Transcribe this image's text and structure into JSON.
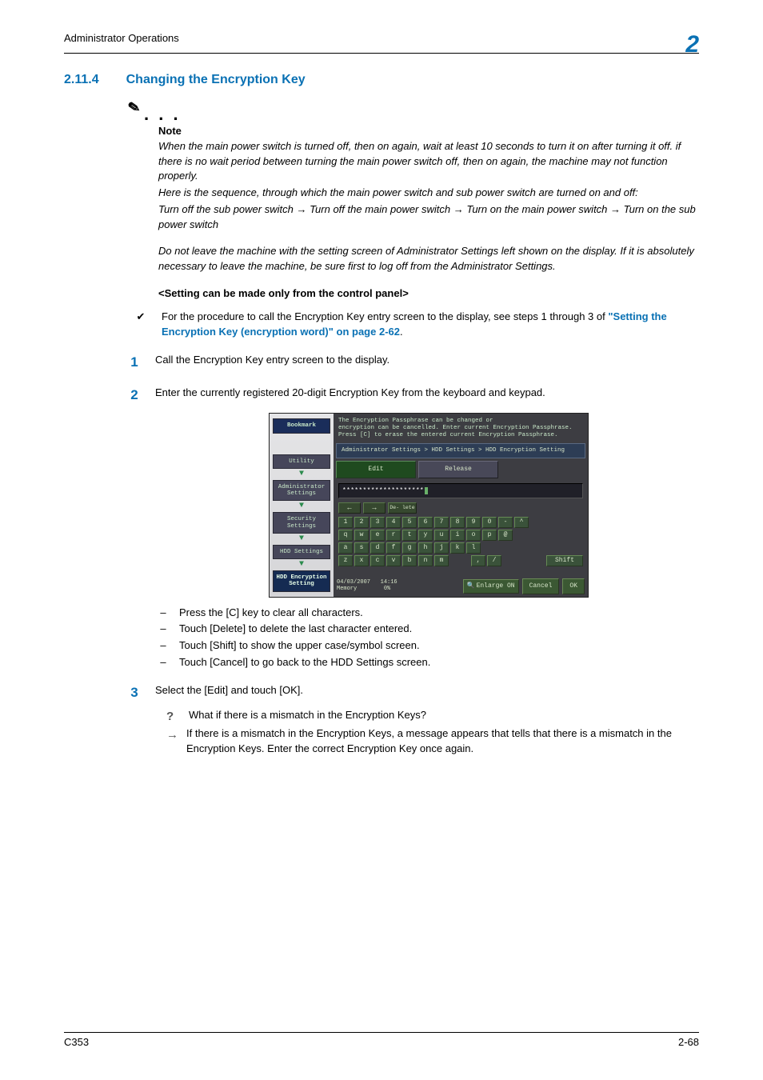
{
  "header": {
    "left": "Administrator Operations",
    "num": "2"
  },
  "section": {
    "num": "2.11.4",
    "title": "Changing the Encryption Key"
  },
  "note": {
    "label": "Note",
    "p1": "When the main power switch is turned off, then on again, wait at least 10 seconds to turn it on after turning it off. if there is no wait period between turning the main power switch off, then on again, the machine may not function properly.",
    "p2": "Here is the sequence, through which the main power switch and sub power switch are turned on and off:",
    "p3_a": "Turn off the sub power switch ",
    "p3_b": " Turn off the main power switch ",
    "p3_c": " Turn on the main power switch ",
    "p3_d": " Turn on the sub power switch",
    "p4": "Do not leave the machine with the setting screen of Administrator Settings left shown on the display. If it is absolutely necessary to leave the machine, be sure first to log off from the Administrator Settings."
  },
  "subheading": "<Setting can be made only from the control panel>",
  "bullet": {
    "text_a": "For the procedure to call the Encryption Key entry screen to the display, see steps 1 through 3 of ",
    "link": "\"Setting the Encryption Key (encryption word)\" on page 2-62",
    "text_b": "."
  },
  "step1": "Call the Encryption Key entry screen to the display.",
  "step2": "Enter the currently registered 20-digit Encryption Key from the keyboard and keypad.",
  "dash": {
    "d1": "Press the [C] key to clear all characters.",
    "d2": "Touch [Delete] to delete the last character entered.",
    "d3": "Touch [Shift] to show the upper case/symbol screen.",
    "d4": "Touch [Cancel] to go back to the HDD Settings screen."
  },
  "step3": "Select the [Edit] and touch [OK].",
  "faq": {
    "q": "What if there is a mismatch in the Encryption Keys?",
    "a": "If there is a mismatch in the Encryption Keys, a message appears that tells that there is a mismatch in the Encryption Keys. Enter the correct Encryption Key once again."
  },
  "panel": {
    "msg1": "The Encryption Passphrase can be changed or",
    "msg2": "encryption can be cancelled. Enter current Encryption Passphrase.",
    "msg3": "Press [C] to erase the entered current Encryption Passphrase.",
    "crumb": "Administrator Settings > HDD Settings > HDD Encryption Setting",
    "tab_edit": "Edit",
    "tab_release": "Release",
    "value": "********************",
    "left": {
      "bookmark": "Bookmark",
      "utility": "Utility",
      "admin": "Administrator Settings",
      "security": "Security Settings",
      "hdd": "HDD Settings",
      "enc": "HDD Encryption Setting"
    },
    "del": "De- lete",
    "shift": "Shift",
    "row1": [
      "1",
      "2",
      "3",
      "4",
      "5",
      "6",
      "7",
      "8",
      "9",
      "0",
      "-",
      "^"
    ],
    "row2": [
      "q",
      "w",
      "e",
      "r",
      "t",
      "y",
      "u",
      "i",
      "o",
      "p",
      "@"
    ],
    "row3": [
      "a",
      "s",
      "d",
      "f",
      "g",
      "h",
      "j",
      "k",
      "l"
    ],
    "row4": [
      "z",
      "x",
      "c",
      "v",
      "b",
      "n",
      "m"
    ],
    "row4b": [
      ",",
      "/"
    ],
    "foot_date": "04/03/2007",
    "foot_time": "14:16",
    "foot_mem": "Memory",
    "foot_memv": "0%",
    "enlarge": "Enlarge ON",
    "cancel": "Cancel",
    "ok": "OK"
  },
  "footer": {
    "left": "C353",
    "right": "2-68"
  }
}
